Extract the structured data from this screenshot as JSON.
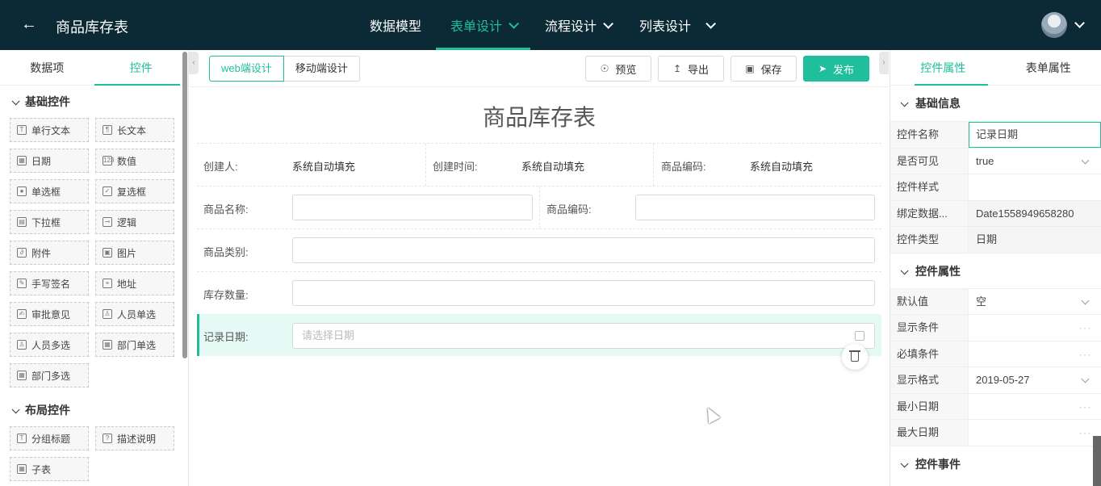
{
  "header": {
    "title": "商品库存表",
    "nav": [
      {
        "label": "数据模型"
      },
      {
        "label": "表单设计"
      },
      {
        "label": "流程设计"
      },
      {
        "label": "列表设计"
      }
    ]
  },
  "left": {
    "tabs": [
      "数据项",
      "控件"
    ],
    "basic_section": "基础控件",
    "layout_section": "布局控件",
    "basic_controls": [
      "单行文本",
      "长文本",
      "日期",
      "数值",
      "单选框",
      "复选框",
      "下拉框",
      "逻辑",
      "附件",
      "图片",
      "手写签名",
      "地址",
      "审批意见",
      "人员单选",
      "人员多选",
      "部门单选",
      "部门多选"
    ],
    "basic_icons": [
      "T",
      "¶",
      "▦",
      "123",
      "●",
      "✓",
      "▤",
      "⊸",
      "∂",
      "▣",
      "✎",
      "⌖",
      "✍",
      "♙",
      "♙",
      "▦",
      "▦"
    ],
    "layout_controls": [
      "分组标题",
      "描述说明",
      "子表"
    ],
    "layout_icons": [
      "T",
      "?",
      "▦"
    ]
  },
  "toolbar": {
    "web": "web端设计",
    "mobile": "移动端设计",
    "preview": "预览",
    "export": "导出",
    "save": "保存",
    "publish": "发布"
  },
  "form": {
    "title": "商品库存表",
    "row1": {
      "creator_label": "创建人:",
      "creator_value": "系统自动填充",
      "created_label": "创建时间:",
      "created_value": "系统自动填充",
      "code_label": "商品编码:",
      "code_value": "系统自动填充"
    },
    "name_label": "商品名称:",
    "code2_label": "商品编码:",
    "category_label": "商品类别:",
    "stock_label": "库存数量:",
    "date_label": "记录日期:",
    "date_placeholder": "请选择日期"
  },
  "right": {
    "tabs": [
      "控件属性",
      "表单属性"
    ],
    "basic_info": "基础信息",
    "basic_rows": [
      {
        "k": "控件名称",
        "v": "记录日期"
      },
      {
        "k": "是否可见",
        "v": "true"
      },
      {
        "k": "控件样式",
        "v": ""
      },
      {
        "k": "绑定数据...",
        "v": "Date1558949658280"
      },
      {
        "k": "控件类型",
        "v": "日期"
      }
    ],
    "props_section": "控件属性",
    "prop_rows": [
      {
        "k": "默认值",
        "v": "空"
      },
      {
        "k": "显示条件",
        "v": ""
      },
      {
        "k": "必填条件",
        "v": ""
      },
      {
        "k": "显示格式",
        "v": "2019-05-27"
      },
      {
        "k": "最小日期",
        "v": ""
      },
      {
        "k": "最大日期",
        "v": ""
      }
    ],
    "events_section": "控件事件"
  },
  "colors": {
    "accent": "#1fbf9c",
    "topbar": "#0b2a36"
  }
}
